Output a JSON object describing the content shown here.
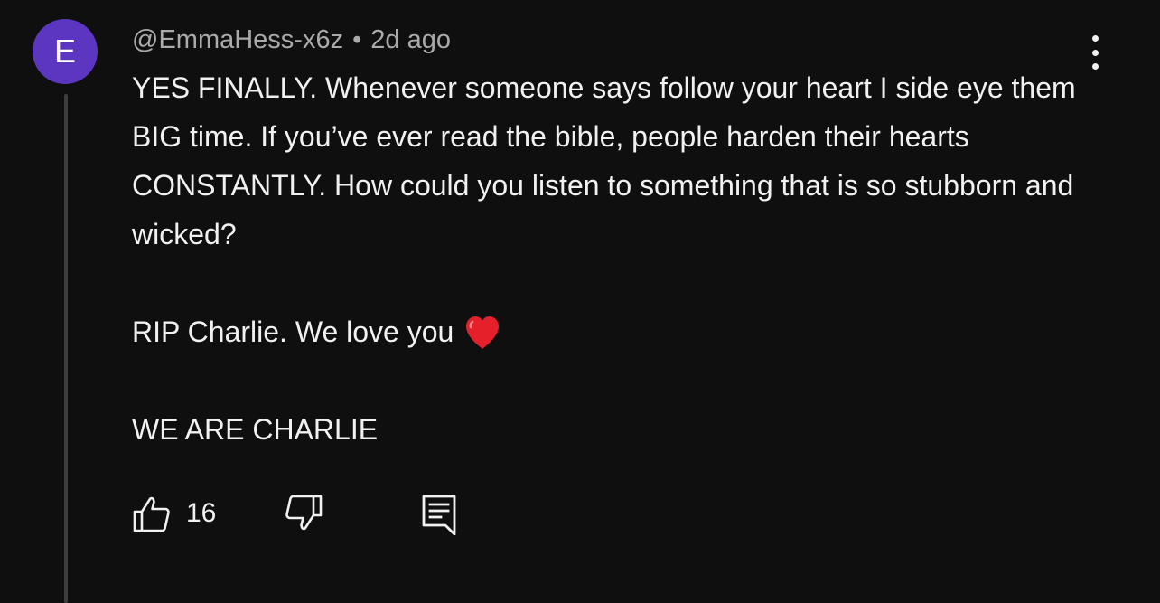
{
  "comment": {
    "avatar_letter": "E",
    "avatar_color": "#5c35c0",
    "username": "@EmmaHess-x6z",
    "separator": "•",
    "timestamp": "2d ago",
    "paragraphs": [
      "YES FINALLY. Whenever someone says follow your heart I side eye them BIG time. If you’ve ever read the bible, people harden their hearts CONSTANTLY. How could you listen to something that is so stubborn and wicked?",
      "RIP Charlie. We love you",
      "WE ARE CHARLIE"
    ],
    "emoji": "red-heart-icon",
    "like_count": "16"
  },
  "icons": {
    "more": "more-vertical-icon",
    "like": "thumbs-up-icon",
    "dislike": "thumbs-down-icon",
    "reply": "reply-comment-icon"
  },
  "colors": {
    "background": "#0f0f0f",
    "text": "#f1f1f1",
    "muted": "#aaaaaa",
    "heart": "#e6202a"
  }
}
